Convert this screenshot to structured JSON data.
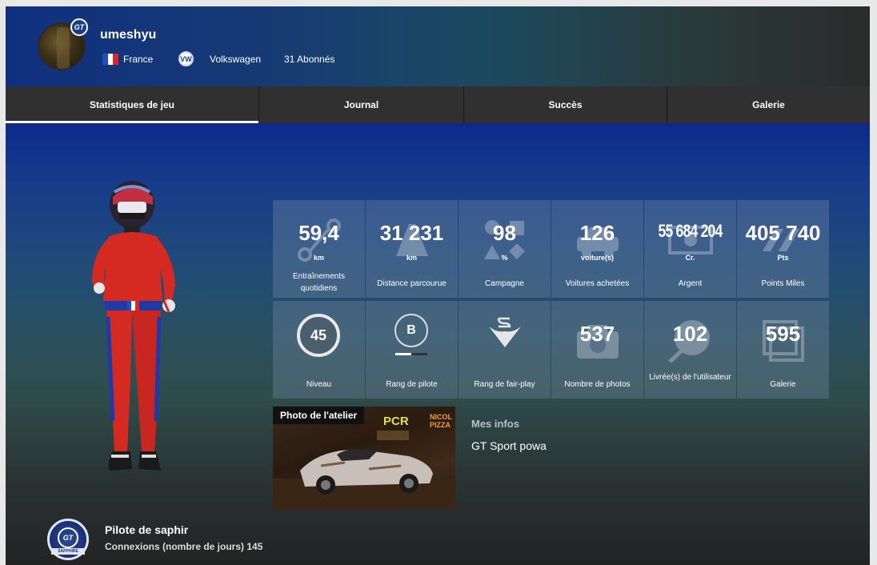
{
  "profile": {
    "username": "umeshyu",
    "badge_text": "GT",
    "country": "France",
    "brand_logo_text": "VW",
    "brand": "Volkswagen",
    "followers": "31 Abonnés"
  },
  "tabs": [
    {
      "label": "Statistiques de jeu",
      "active": true
    },
    {
      "label": "Journal",
      "active": false
    },
    {
      "label": "Succès",
      "active": false
    },
    {
      "label": "Galerie",
      "active": false
    }
  ],
  "stats_row1": [
    {
      "value": "59,4",
      "unit": "km",
      "label": "Entraînements quotidiens",
      "icon": "route-icon"
    },
    {
      "value": "31 231",
      "unit": "km",
      "label": "Distance parcourue",
      "icon": "road-icon"
    },
    {
      "value": "98",
      "unit": "%",
      "label": "Campagne",
      "icon": "shapes-icon"
    },
    {
      "value": "126",
      "unit": "voiture(s)",
      "label": "Voitures achetées",
      "icon": "car-icon"
    },
    {
      "value": "55 684 204",
      "unit": "Cr.",
      "label": "Argent",
      "icon": "money-icon"
    },
    {
      "value": "405 740",
      "unit": "Pts",
      "label": "Points Miles",
      "icon": "miles-icon"
    }
  ],
  "stats_row2": [
    {
      "value": "45",
      "label": "Niveau",
      "icon": "level-ring-icon"
    },
    {
      "value": "B",
      "label": "Rang de pilote",
      "icon": "driver-rank-icon",
      "progress": 0.5
    },
    {
      "value": "S",
      "label": "Rang de fair-play",
      "icon": "handshake-icon"
    },
    {
      "value": "537",
      "label": "Nombre de photos",
      "icon": "camera-icon"
    },
    {
      "value": "102",
      "label": "Livrée(s) de l'utilisateur",
      "icon": "palette-icon"
    },
    {
      "value": "595",
      "label": "Galerie",
      "icon": "gallery-icon"
    }
  ],
  "atelier": {
    "title": "Photo de l'atelier",
    "neon_1": "PCR",
    "neon_2": "NICOL PIZZA"
  },
  "infos": {
    "title": "Mes infos",
    "text": "GT Sport powa"
  },
  "rank": {
    "badge_inner": "GT",
    "badge_ribbon": "SAPPHIRE",
    "title": "Pilote de saphir",
    "logins": "Connexions (nombre de jours) 145"
  },
  "colors": {
    "flag_blue": "#1f4fc0",
    "flag_white": "#ffffff",
    "flag_red": "#e0242a",
    "suit_red": "#d42a22"
  }
}
